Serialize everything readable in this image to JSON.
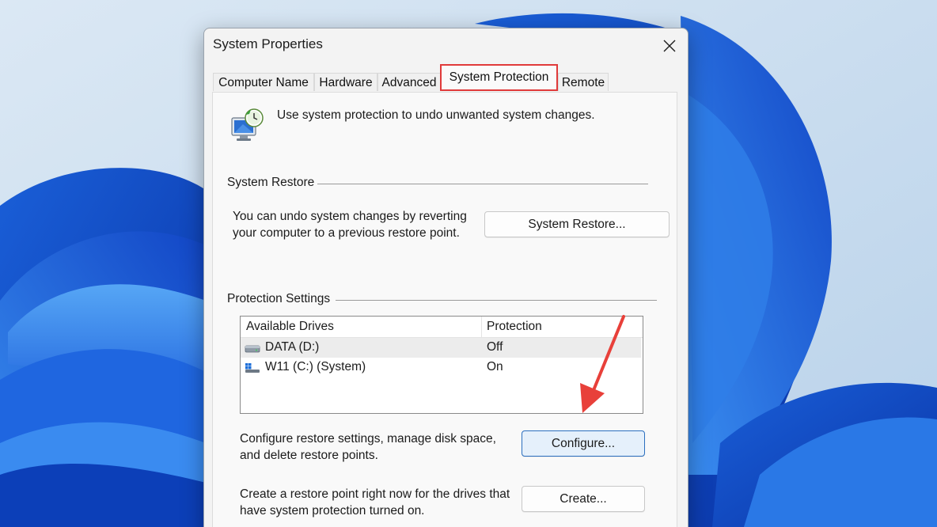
{
  "window": {
    "title": "System Properties",
    "close_icon": "close-icon"
  },
  "tabs": [
    {
      "label": "Computer Name",
      "active": false
    },
    {
      "label": "Hardware",
      "active": false
    },
    {
      "label": "Advanced",
      "active": false
    },
    {
      "label": "System Protection",
      "active": true
    },
    {
      "label": "Remote",
      "active": false
    }
  ],
  "intro": {
    "icon": "system-protection-icon",
    "text": "Use system protection to undo unwanted system changes."
  },
  "system_restore": {
    "section_label": "System Restore",
    "description_line1": "You can undo system changes by reverting",
    "description_line2": "your computer to a previous restore point.",
    "button_label": "System Restore..."
  },
  "protection_settings": {
    "section_label": "Protection Settings",
    "columns": [
      "Available Drives",
      "Protection"
    ],
    "drives": [
      {
        "name": "DATA (D:)",
        "protection": "Off",
        "icon": "drive-icon",
        "selected": true
      },
      {
        "name": "W11 (C:) (System)",
        "protection": "On",
        "icon": "windows-drive-icon",
        "selected": false
      }
    ],
    "configure_text_line1": "Configure restore settings, manage disk space,",
    "configure_text_line2": "and delete restore points.",
    "configure_button": "Configure...",
    "create_text_line1": "Create a restore point right now for the drives that",
    "create_text_line2": "have system protection turned on.",
    "create_button": "Create..."
  },
  "annotations": {
    "highlight_color": "#e03a3a",
    "arrow_color": "#e8403a"
  }
}
